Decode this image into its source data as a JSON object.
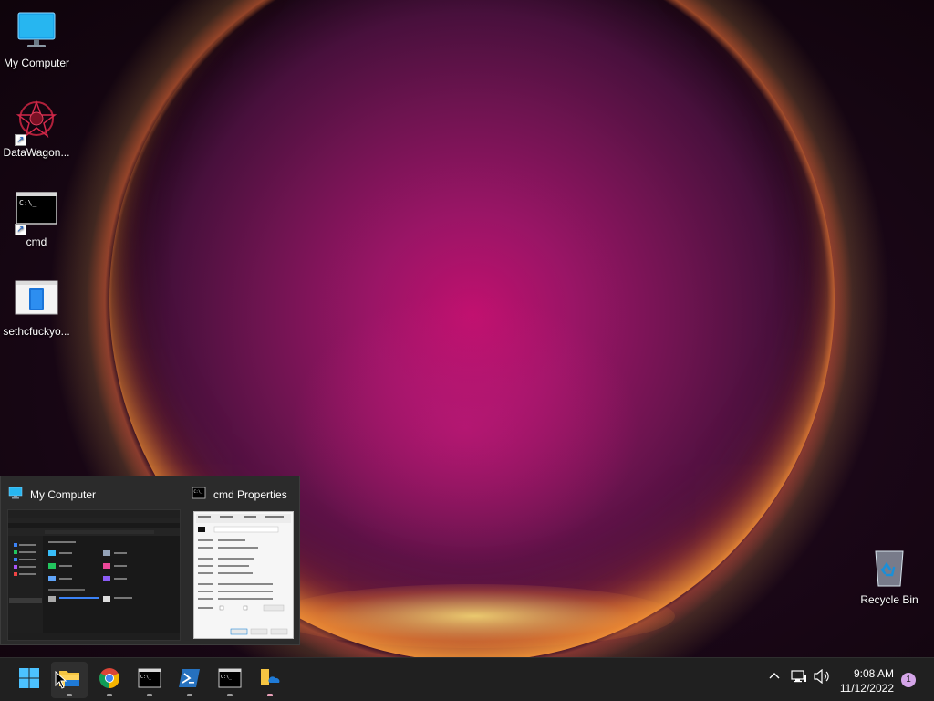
{
  "desktop": {
    "icons": [
      {
        "label": "My Computer"
      },
      {
        "label": "DataWagon..."
      },
      {
        "label": "cmd"
      },
      {
        "label": "sethcfuckyo..."
      },
      {
        "label": "Recycle Bin"
      }
    ]
  },
  "preview": {
    "items": [
      {
        "title": "My Computer"
      },
      {
        "title": "cmd Properties"
      }
    ]
  },
  "taskbar": {
    "apps": [
      {
        "name": "start-button"
      },
      {
        "name": "file-explorer"
      },
      {
        "name": "chrome"
      },
      {
        "name": "cmd"
      },
      {
        "name": "powershell"
      },
      {
        "name": "cmd"
      },
      {
        "name": "onedrive-folder"
      }
    ],
    "clock": {
      "time": "9:08 AM",
      "date": "11/12/2022"
    },
    "notification_count": "1"
  },
  "colors": {
    "taskbar": "#202020",
    "accent": "#0078d4",
    "notification_badge": "#d4a5e8"
  }
}
